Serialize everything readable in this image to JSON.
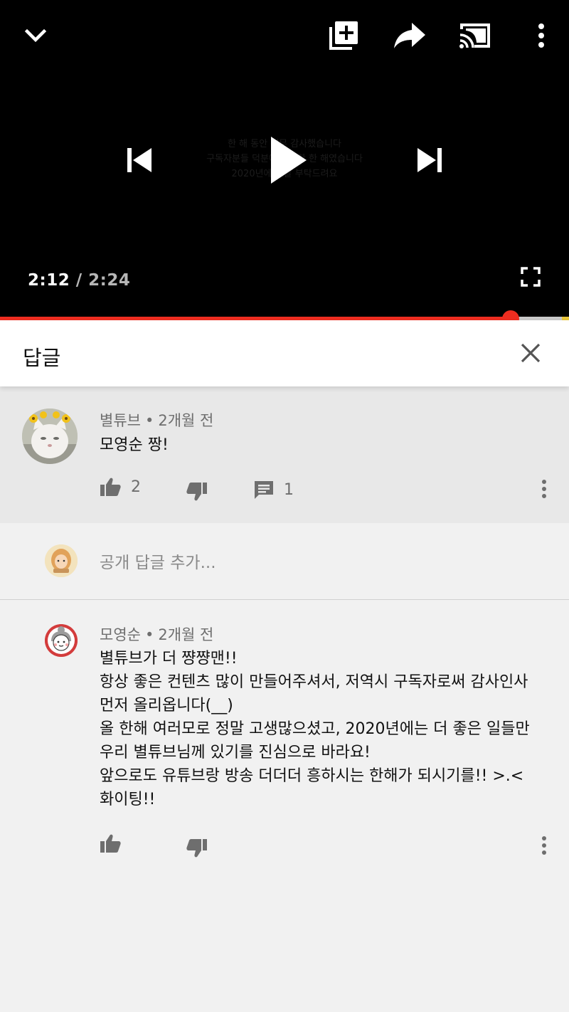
{
  "player": {
    "current_time": "2:12",
    "separator": " / ",
    "total_time": "2:24",
    "progress_fraction": 0.898,
    "buffer_fraction": 0.99,
    "overlay_text_lines": [
      "한 해 동안 너무 감사했습니다",
      "구독자분들 덕분에 행복한 한 해였습니다",
      "2020년에도 잘 부탁드려요"
    ]
  },
  "colors": {
    "player_bg": "#000000",
    "progress_red": "#ee2d20",
    "parent_bg": "#e8e8e8",
    "page_bg": "#f1f1f1"
  },
  "icons": {
    "collapse": "chevron-down-icon",
    "add_to_playlist": "playlist-add-icon",
    "share": "share-icon",
    "cast": "cast-icon",
    "more": "more-vertical-icon",
    "previous": "skip-previous-icon",
    "play": "play-icon",
    "next": "skip-next-icon",
    "fullscreen": "fullscreen-icon",
    "close": "close-icon",
    "like": "thumbs-up-icon",
    "dislike": "thumbs-down-icon",
    "reply": "reply-comment-icon"
  },
  "replies_panel": {
    "title": "답글"
  },
  "parent_comment": {
    "author": "별튜브",
    "dot": "•",
    "time": "2개월 전",
    "text": "모영순 짱!",
    "likes": "2",
    "replies": "1"
  },
  "add_reply": {
    "placeholder": "공개 답글 추가..."
  },
  "reply": {
    "author": "모영순",
    "dot": "•",
    "time": "2개월 전",
    "text": "별튜브가 더 쨩쨩맨!!\n항상 좋은 컨텐츠 많이 만들어주셔서, 저역시 구독자로써 감사인사 먼저 올리옵니다(__)\n올 한해 여러모로 정말 고생많으셨고, 2020년에는 더 좋은 일들만 우리 별튜브님께 있기를 진심으로 바라요!\n앞으로도 유튜브랑 방송 더더더 흥하시는 한해가 되시기를!! >.< 화이팅!!"
  }
}
